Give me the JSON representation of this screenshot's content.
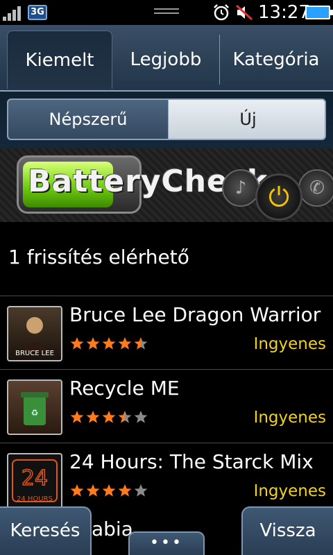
{
  "status_bar": {
    "network_badge": "3G",
    "time": "13:27",
    "icons": [
      "signal-icon",
      "handle-icon",
      "alarm-icon",
      "mute-icon",
      "battery-icon"
    ]
  },
  "tabs": [
    {
      "label": "Kiemelt",
      "active": true
    },
    {
      "label": "Legjobb",
      "active": false
    },
    {
      "label": "Kategória",
      "active": false
    }
  ],
  "segment": {
    "left_label": "Népszerű",
    "right_label": "Új",
    "selected": "left"
  },
  "banner": {
    "title": "BatteryCheck",
    "icons": [
      "music-note-icon",
      "power-icon",
      "phone-icon"
    ]
  },
  "update_text": "1 frissítés elérhető",
  "apps": [
    {
      "name": "Bruce Lee Dragon Warrior",
      "rating": 4.5,
      "price": "Ingyenes",
      "thumb_caption": "BRUCE LEE"
    },
    {
      "name": "Recycle ME",
      "rating": 3.5,
      "price": "Ingyenes",
      "thumb_caption": ""
    },
    {
      "name": "24 Hours: The Starck Mix",
      "rating": 4,
      "price": "Ingyenes",
      "thumb_caption": "24 HOURS"
    }
  ],
  "peek_text": "abia",
  "bottom_bar": {
    "left_label": "Keresés",
    "right_label": "Vissza",
    "more_label": "•••"
  },
  "colors": {
    "price": "#f2d50d",
    "star_filled": "#ff7a1a",
    "star_empty": "#8a8a8a"
  }
}
